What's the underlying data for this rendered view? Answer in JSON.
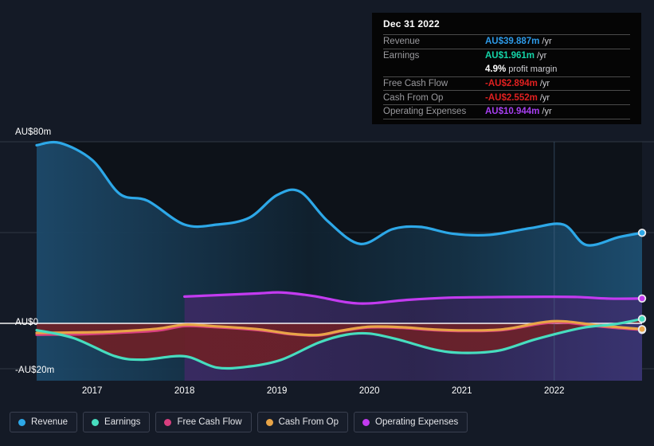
{
  "chart_data": {
    "type": "area",
    "title": "",
    "xlabel": "",
    "ylabel": "",
    "currency": "AU$",
    "unit": "m",
    "ylim": [
      -20,
      80
    ],
    "grid": true,
    "gridlines": [
      80,
      40,
      0,
      -20
    ],
    "y_ticks": [
      {
        "value": 80,
        "label": "AU$80m"
      },
      {
        "value": 0,
        "label": "AU$0"
      },
      {
        "value": -20,
        "label": "-AU$20m"
      }
    ],
    "x_ticks": [
      "2017",
      "2018",
      "2019",
      "2020",
      "2021",
      "2022"
    ],
    "x_range": [
      "2016.4",
      "2022.95"
    ],
    "legend_position": "bottom-left",
    "forecast_divider_x": "2022",
    "series": [
      {
        "name": "Revenue",
        "color": "#2da8e8",
        "fill": "#1d4561",
        "points": [
          {
            "x": 2016.4,
            "y": 78.5
          },
          {
            "x": 2016.65,
            "y": 79.5
          },
          {
            "x": 2017.0,
            "y": 72.0
          },
          {
            "x": 2017.3,
            "y": 57.0
          },
          {
            "x": 2017.6,
            "y": 54.0
          },
          {
            "x": 2018.0,
            "y": 43.5
          },
          {
            "x": 2018.35,
            "y": 43.5
          },
          {
            "x": 2018.7,
            "y": 46.5
          },
          {
            "x": 2019.0,
            "y": 56.5
          },
          {
            "x": 2019.25,
            "y": 58.0
          },
          {
            "x": 2019.55,
            "y": 45.0
          },
          {
            "x": 2019.9,
            "y": 35.0
          },
          {
            "x": 2020.25,
            "y": 41.5
          },
          {
            "x": 2020.55,
            "y": 42.5
          },
          {
            "x": 2020.9,
            "y": 39.5
          },
          {
            "x": 2021.3,
            "y": 39.0
          },
          {
            "x": 2021.75,
            "y": 42.0
          },
          {
            "x": 2022.1,
            "y": 43.5
          },
          {
            "x": 2022.35,
            "y": 34.5
          },
          {
            "x": 2022.7,
            "y": 38.0
          },
          {
            "x": 2022.95,
            "y": 39.887
          }
        ],
        "endpoint": {
          "x": 2022.95,
          "y": 39.887
        }
      },
      {
        "name": "Earnings",
        "color": "#47ddbf",
        "fill": "#6c1f26",
        "points": [
          {
            "x": 2016.4,
            "y": -3.0
          },
          {
            "x": 2016.8,
            "y": -6.5
          },
          {
            "x": 2017.25,
            "y": -14.5
          },
          {
            "x": 2017.55,
            "y": -16.0
          },
          {
            "x": 2018.0,
            "y": -14.5
          },
          {
            "x": 2018.35,
            "y": -19.5
          },
          {
            "x": 2018.7,
            "y": -19.0
          },
          {
            "x": 2019.05,
            "y": -16.0
          },
          {
            "x": 2019.45,
            "y": -8.5
          },
          {
            "x": 2019.75,
            "y": -5.0
          },
          {
            "x": 2020.0,
            "y": -4.5
          },
          {
            "x": 2020.3,
            "y": -7.0
          },
          {
            "x": 2020.7,
            "y": -11.5
          },
          {
            "x": 2021.0,
            "y": -13.0
          },
          {
            "x": 2021.4,
            "y": -12.0
          },
          {
            "x": 2021.8,
            "y": -7.0
          },
          {
            "x": 2022.3,
            "y": -2.0
          },
          {
            "x": 2022.65,
            "y": -0.4
          },
          {
            "x": 2022.95,
            "y": 1.961
          }
        ],
        "endpoint": {
          "x": 2022.95,
          "y": 1.961
        }
      },
      {
        "name": "Free Cash Flow",
        "color": "#d83f7f",
        "points": [
          {
            "x": 2016.4,
            "y": -5.0
          },
          {
            "x": 2016.9,
            "y": -4.8
          },
          {
            "x": 2017.25,
            "y": -4.2
          },
          {
            "x": 2017.7,
            "y": -3.2
          },
          {
            "x": 2018.0,
            "y": -1.2
          },
          {
            "x": 2018.3,
            "y": -1.6
          },
          {
            "x": 2018.8,
            "y": -3.0
          },
          {
            "x": 2019.15,
            "y": -4.8
          },
          {
            "x": 2019.45,
            "y": -5.3
          },
          {
            "x": 2019.7,
            "y": -3.4
          },
          {
            "x": 2020.0,
            "y": -1.8
          },
          {
            "x": 2020.35,
            "y": -2.0
          },
          {
            "x": 2020.7,
            "y": -3.0
          },
          {
            "x": 2021.05,
            "y": -3.4
          },
          {
            "x": 2021.45,
            "y": -2.9
          },
          {
            "x": 2021.85,
            "y": -0.2
          },
          {
            "x": 2022.1,
            "y": 0.4
          },
          {
            "x": 2022.5,
            "y": -1.4
          },
          {
            "x": 2022.95,
            "y": -2.894
          }
        ],
        "endpoint": {
          "x": 2022.95,
          "y": -2.894
        }
      },
      {
        "name": "Cash From Op",
        "color": "#e8a447",
        "points": [
          {
            "x": 2016.4,
            "y": -4.2
          },
          {
            "x": 2016.9,
            "y": -4.0
          },
          {
            "x": 2017.25,
            "y": -3.6
          },
          {
            "x": 2017.7,
            "y": -2.4
          },
          {
            "x": 2018.0,
            "y": -0.6
          },
          {
            "x": 2018.3,
            "y": -1.2
          },
          {
            "x": 2018.8,
            "y": -2.6
          },
          {
            "x": 2019.15,
            "y": -4.6
          },
          {
            "x": 2019.45,
            "y": -5.1
          },
          {
            "x": 2019.7,
            "y": -3.2
          },
          {
            "x": 2020.0,
            "y": -1.5
          },
          {
            "x": 2020.35,
            "y": -1.7
          },
          {
            "x": 2020.7,
            "y": -2.7
          },
          {
            "x": 2021.05,
            "y": -3.1
          },
          {
            "x": 2021.45,
            "y": -2.6
          },
          {
            "x": 2021.85,
            "y": 0.3
          },
          {
            "x": 2022.1,
            "y": 0.9
          },
          {
            "x": 2022.5,
            "y": -1.0
          },
          {
            "x": 2022.95,
            "y": -2.552
          }
        ],
        "endpoint": {
          "x": 2022.95,
          "y": -2.552
        }
      },
      {
        "name": "Operating Expenses",
        "color": "#c33bf0",
        "fill": "#3b2a63",
        "start_x": 2018.0,
        "points": [
          {
            "x": 2018.0,
            "y": 11.8
          },
          {
            "x": 2018.45,
            "y": 12.6
          },
          {
            "x": 2018.8,
            "y": 13.2
          },
          {
            "x": 2019.05,
            "y": 13.6
          },
          {
            "x": 2019.4,
            "y": 12.0
          },
          {
            "x": 2019.75,
            "y": 9.3
          },
          {
            "x": 2020.0,
            "y": 8.8
          },
          {
            "x": 2020.4,
            "y": 10.3
          },
          {
            "x": 2020.85,
            "y": 11.3
          },
          {
            "x": 2021.4,
            "y": 11.6
          },
          {
            "x": 2021.9,
            "y": 11.7
          },
          {
            "x": 2022.25,
            "y": 11.6
          },
          {
            "x": 2022.6,
            "y": 10.9
          },
          {
            "x": 2022.95,
            "y": 10.944
          }
        ],
        "endpoint": {
          "x": 2022.95,
          "y": 10.944
        }
      }
    ]
  },
  "tooltip": {
    "date": "Dec 31 2022",
    "rows": [
      {
        "key": "Revenue",
        "value": "AU$39.887m",
        "unit": "/yr",
        "color": "#2d9ae8"
      },
      {
        "key": "Earnings",
        "value": "AU$1.961m",
        "unit": "/yr",
        "color": "#14d4a8"
      },
      {
        "key": "",
        "value": "4.9%",
        "unit": "profit margin",
        "color": "#ffffff"
      },
      {
        "key": "Free Cash Flow",
        "value": "-AU$2.894m",
        "unit": "/yr",
        "color": "#e02020"
      },
      {
        "key": "Cash From Op",
        "value": "-AU$2.552m",
        "unit": "/yr",
        "color": "#e02020"
      },
      {
        "key": "Operating Expenses",
        "value": "AU$10.944m",
        "unit": "/yr",
        "color": "#a63ff0"
      }
    ]
  },
  "legend": {
    "items": [
      {
        "label": "Revenue",
        "color": "#2da8e8"
      },
      {
        "label": "Earnings",
        "color": "#47ddbf"
      },
      {
        "label": "Free Cash Flow",
        "color": "#d83f7f"
      },
      {
        "label": "Cash From Op",
        "color": "#e8a447"
      },
      {
        "label": "Operating Expenses",
        "color": "#c33bf0"
      }
    ]
  },
  "colors": {
    "background": "#141a26",
    "plot_background": "#0d1219",
    "tooltip_background": "#050505",
    "gridline": "#3a4454",
    "zero_line": "#ffffff"
  }
}
